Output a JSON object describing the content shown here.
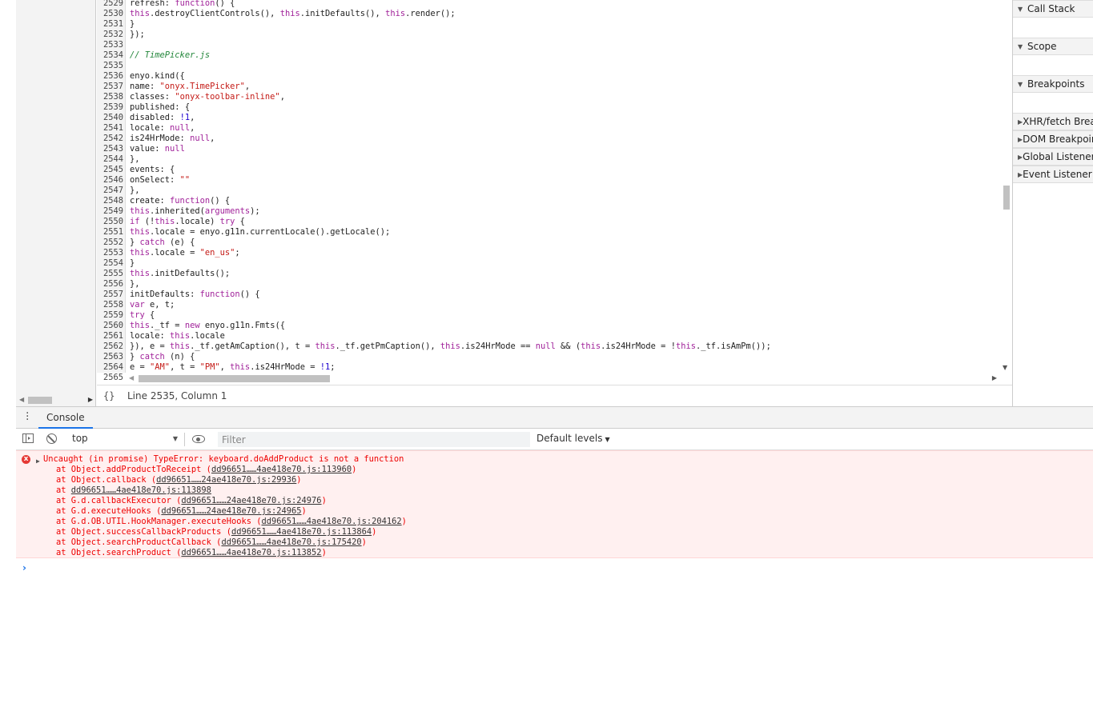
{
  "editor": {
    "lines": [
      {
        "n": "2529",
        "html": "refresh: <span class='kw'>function</span>() {"
      },
      {
        "n": "2530",
        "html": "<span class='kw'>this</span>.destroyClientControls(), <span class='kw'>this</span>.initDefaults(), <span class='kw'>this</span>.render();"
      },
      {
        "n": "2531",
        "html": "}"
      },
      {
        "n": "2532",
        "html": "});"
      },
      {
        "n": "2533",
        "html": ""
      },
      {
        "n": "2534",
        "html": "<span class='com'>// TimePicker.js</span>"
      },
      {
        "n": "2535",
        "html": ""
      },
      {
        "n": "2536",
        "html": "enyo.kind({"
      },
      {
        "n": "2537",
        "html": "name: <span class='str'>\"onyx.TimePicker\"</span>,"
      },
      {
        "n": "2538",
        "html": "classes: <span class='str'>\"onyx-toolbar-inline\"</span>,"
      },
      {
        "n": "2539",
        "html": "published: {"
      },
      {
        "n": "2540",
        "html": "disabled: <span class='num'>!1</span>,"
      },
      {
        "n": "2541",
        "html": "locale: <span class='kw'>null</span>,"
      },
      {
        "n": "2542",
        "html": "is24HrMode: <span class='kw'>null</span>,"
      },
      {
        "n": "2543",
        "html": "value: <span class='kw'>null</span>"
      },
      {
        "n": "2544",
        "html": "},"
      },
      {
        "n": "2545",
        "html": "events: {"
      },
      {
        "n": "2546",
        "html": "onSelect: <span class='str'>\"\"</span>"
      },
      {
        "n": "2547",
        "html": "},"
      },
      {
        "n": "2548",
        "html": "create: <span class='kw'>function</span>() {"
      },
      {
        "n": "2549",
        "html": "<span class='kw'>this</span>.inherited(<span class='kw'>arguments</span>);"
      },
      {
        "n": "2550",
        "html": "<span class='kw'>if</span> (!<span class='kw'>this</span>.locale) <span class='kw'>try</span> {"
      },
      {
        "n": "2551",
        "html": "<span class='kw'>this</span>.locale = enyo.g11n.currentLocale().getLocale();"
      },
      {
        "n": "2552",
        "html": "} <span class='kw'>catch</span> (e) {"
      },
      {
        "n": "2553",
        "html": "<span class='kw'>this</span>.locale = <span class='str'>\"en_us\"</span>;"
      },
      {
        "n": "2554",
        "html": "}"
      },
      {
        "n": "2555",
        "html": "<span class='kw'>this</span>.initDefaults();"
      },
      {
        "n": "2556",
        "html": "},"
      },
      {
        "n": "2557",
        "html": "initDefaults: <span class='kw'>function</span>() {"
      },
      {
        "n": "2558",
        "html": "<span class='kw'>var</span> e, t;"
      },
      {
        "n": "2559",
        "html": "<span class='kw'>try</span> {"
      },
      {
        "n": "2560",
        "html": "<span class='kw'>this</span>._tf = <span class='kw'>new</span> enyo.g11n.Fmts({"
      },
      {
        "n": "2561",
        "html": "locale: <span class='kw'>this</span>.locale"
      },
      {
        "n": "2562",
        "html": "}), e = <span class='kw'>this</span>._tf.getAmCaption(), t = <span class='kw'>this</span>._tf.getPmCaption(), <span class='kw'>this</span>.is24HrMode == <span class='kw'>null</span> &amp;&amp; (<span class='kw'>this</span>.is24HrMode = !<span class='kw'>this</span>._tf.isAmPm());"
      },
      {
        "n": "2563",
        "html": "} <span class='kw'>catch</span> (n) {"
      },
      {
        "n": "2564",
        "html": "e = <span class='str'>\"AM\"</span>, t = <span class='str'>\"PM\"</span>, <span class='kw'>this</span>.is24HrMode = <span class='num'>!1</span>;"
      },
      {
        "n": "2565",
        "html": ""
      }
    ]
  },
  "status": {
    "braces": "{}",
    "position": "Line 2535, Column 1"
  },
  "sidebar": {
    "sections": [
      {
        "label": "Call Stack",
        "expanded": true
      },
      {
        "label": "Scope",
        "expanded": true
      },
      {
        "label": "Breakpoints",
        "expanded": true
      },
      {
        "label": "XHR/fetch Breakpoints",
        "expanded": false
      },
      {
        "label": "DOM Breakpoints",
        "expanded": false
      },
      {
        "label": "Global Listeners",
        "expanded": false
      },
      {
        "label": "Event Listener Breakpoints",
        "expanded": false
      }
    ]
  },
  "drawer": {
    "tab_label": "Console"
  },
  "console_toolbar": {
    "context": "top",
    "filter_placeholder": "Filter",
    "levels": "Default levels"
  },
  "error": {
    "icon": "x",
    "headline": "Uncaught (in promise) TypeError: keyboard.doAddProduct is not a function",
    "stack": [
      {
        "prefix": "at Object.addProductToReceipt (",
        "link": "dd96651……4ae418e70.js:113960",
        "suffix": ")"
      },
      {
        "prefix": "at Object.callback (",
        "link": "dd96651……24ae418e70.js:29936",
        "suffix": ")"
      },
      {
        "prefix": "at ",
        "link": "dd96651……4ae418e70.js:113898",
        "suffix": ""
      },
      {
        "prefix": "at G.d.callbackExecutor (",
        "link": "dd96651……24ae418e70.js:24976",
        "suffix": ")"
      },
      {
        "prefix": "at G.d.executeHooks (",
        "link": "dd96651……24ae418e70.js:24965",
        "suffix": ")"
      },
      {
        "prefix": "at G.d.OB.UTIL.HookManager.executeHooks (",
        "link": "dd96651……4ae418e70.js:204162",
        "suffix": ")"
      },
      {
        "prefix": "at Object.successCallbackProducts (",
        "link": "dd96651……4ae418e70.js:113864",
        "suffix": ")"
      },
      {
        "prefix": "at Object.searchProductCallback (",
        "link": "dd96651……4ae418e70.js:175420",
        "suffix": ")"
      },
      {
        "prefix": "at Object.searchProduct (",
        "link": "dd96651……4ae418e70.js:113852",
        "suffix": ")"
      }
    ]
  },
  "prompt": "›",
  "colors": {
    "error_bg": "#fff0f0",
    "error_text": "#e00000",
    "accent": "#1a73e8"
  }
}
